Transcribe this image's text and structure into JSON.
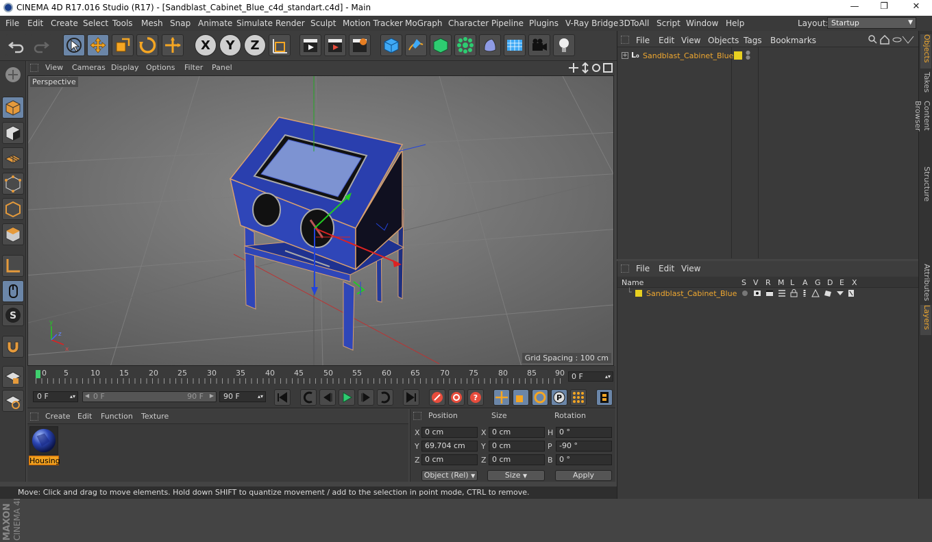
{
  "window": {
    "title": "CINEMA 4D R17.016 Studio (R17) - [Sandblast_Cabinet_Blue_c4d_standart.c4d] - Main",
    "minimize": "—",
    "maximize": "❐",
    "close": "✕"
  },
  "menubar": {
    "items": [
      "File",
      "Edit",
      "Create",
      "Select",
      "Tools",
      "Mesh",
      "Snap",
      "Animate",
      "Simulate",
      "Render",
      "Sculpt",
      "Motion Tracker",
      "MoGraph",
      "Character",
      "Pipeline",
      "Plugins",
      "V-Ray Bridge",
      "3DToAll",
      "Script",
      "Window",
      "Help"
    ],
    "layout_label": "Layout:",
    "layout_value": "Startup"
  },
  "toolbar": {
    "x_label": "X",
    "y_label": "Y",
    "z_label": "Z"
  },
  "viewport": {
    "menu": [
      "View",
      "Cameras",
      "Display",
      "Options",
      "Filter",
      "Panel"
    ],
    "camera_label": "Perspective",
    "grid_spacing": "Grid Spacing : 100 cm",
    "axis_x": "x",
    "axis_y": "y",
    "axis_z": "z"
  },
  "timeline": {
    "ticks": [
      "0",
      "5",
      "10",
      "15",
      "20",
      "25",
      "30",
      "35",
      "40",
      "45",
      "50",
      "55",
      "60",
      "65",
      "70",
      "75",
      "80",
      "85",
      "90"
    ],
    "current_frame": "0 F"
  },
  "transport": {
    "start_field": "0 F",
    "range_start": "0 F",
    "range_end": "90 F",
    "end_field": "90 F"
  },
  "material_manager": {
    "menu": [
      "Create",
      "Edit",
      "Function",
      "Texture"
    ],
    "material_name": "Housing"
  },
  "coordinates": {
    "headers": {
      "position": "Position",
      "size": "Size",
      "rotation": "Rotation"
    },
    "rows": [
      {
        "axis": "X",
        "pos": "0 cm",
        "size_axis": "X",
        "size": "0 cm",
        "rot_axis": "H",
        "rot": "0 °"
      },
      {
        "axis": "Y",
        "pos": "69.704 cm",
        "size_axis": "Y",
        "size": "0 cm",
        "rot_axis": "P",
        "rot": "-90 °"
      },
      {
        "axis": "Z",
        "pos": "0 cm",
        "size_axis": "Z",
        "size": "0 cm",
        "rot_axis": "B",
        "rot": "0 °"
      }
    ],
    "mode_select": "Object (Rel)",
    "size_select": "Size",
    "apply": "Apply"
  },
  "status": {
    "text": "Move: Click and drag to move elements. Hold down SHIFT to quantize movement / add to the selection in point mode, CTRL to remove."
  },
  "object_manager": {
    "menu": [
      "File",
      "Edit",
      "View",
      "Objects",
      "Tags",
      "Bookmarks"
    ],
    "object_name": "Sandblast_Cabinet_Blue"
  },
  "layer_manager": {
    "menu": [
      "File",
      "Edit",
      "View"
    ],
    "columns": [
      "Name",
      "S",
      "V",
      "R",
      "M",
      "L",
      "A",
      "G",
      "D",
      "E",
      "X"
    ],
    "layer_name": "Sandblast_Cabinet_Blue"
  },
  "right_tabs": {
    "objects": "Objects",
    "takes": "Takes",
    "content_browser": "Content Browser",
    "structure": "Structure",
    "attributes": "Attributes",
    "layers": "Layers"
  },
  "colors": {
    "accent_orange": "#f0a830",
    "selected_blue": "#6b86a8",
    "cabinet_blue": "#2f46b8"
  }
}
